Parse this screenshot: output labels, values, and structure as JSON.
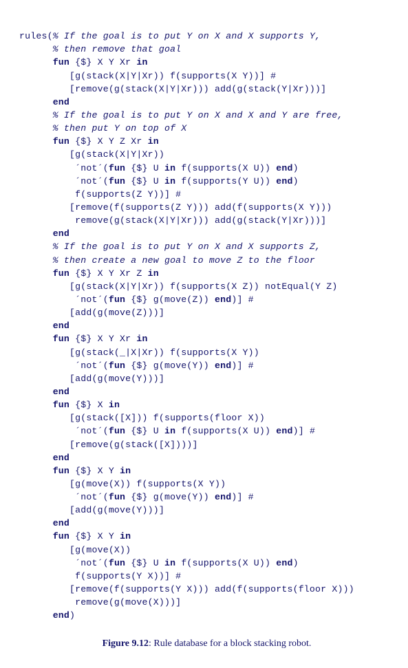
{
  "code": {
    "l01_a": "rules(",
    "l01_b": "% If the goal is to put Y on X and X supports Y,",
    "l02": "      % then remove that goal",
    "l03_a": "      ",
    "l03_b": "fun",
    "l03_c": " {$} X Y Xr ",
    "l03_d": "in",
    "l04": "         [g(stack(X|Y|Xr)) f(supports(X Y))] #",
    "l05": "         [remove(g(stack(X|Y|Xr))) add(g(stack(Y|Xr)))]",
    "l06_a": "      ",
    "l06_b": "end",
    "l07": "      % If the goal is to put Y on X and X and Y are free,",
    "l08": "      % then put Y on top of X",
    "l09_a": "      ",
    "l09_b": "fun",
    "l09_c": " {$} X Y Z Xr ",
    "l09_d": "in",
    "l10": "         [g(stack(X|Y|Xr))",
    "l11_a": "          ´not´(",
    "l11_b": "fun",
    "l11_c": " {$} U ",
    "l11_d": "in",
    "l11_e": " f(supports(X U)) ",
    "l11_f": "end",
    "l11_g": ")",
    "l12_a": "          ´not´(",
    "l12_b": "fun",
    "l12_c": " {$} U ",
    "l12_d": "in",
    "l12_e": " f(supports(Y U)) ",
    "l12_f": "end",
    "l12_g": ")",
    "l13": "          f(supports(Z Y))] #",
    "l14": "         [remove(f(supports(Z Y))) add(f(supports(X Y)))",
    "l15": "          remove(g(stack(X|Y|Xr))) add(g(stack(Y|Xr)))]",
    "l16_a": "      ",
    "l16_b": "end",
    "l17": "      % If the goal is to put Y on X and X supports Z,",
    "l18": "      % then create a new goal to move Z to the floor",
    "l19_a": "      ",
    "l19_b": "fun",
    "l19_c": " {$} X Y Xr Z ",
    "l19_d": "in",
    "l20": "         [g(stack(X|Y|Xr)) f(supports(X Z)) notEqual(Y Z)",
    "l21_a": "          ´not´(",
    "l21_b": "fun",
    "l21_c": " {$} g(move(Z)) ",
    "l21_d": "end",
    "l21_e": ")] #",
    "l22": "         [add(g(move(Z)))]",
    "l23_a": "      ",
    "l23_b": "end",
    "l24_a": "      ",
    "l24_b": "fun",
    "l24_c": " {$} X Y Xr ",
    "l24_d": "in",
    "l25": "         [g(stack(_|X|Xr)) f(supports(X Y))",
    "l26_a": "          ´not´(",
    "l26_b": "fun",
    "l26_c": " {$} g(move(Y)) ",
    "l26_d": "end",
    "l26_e": ")] #",
    "l27": "         [add(g(move(Y)))]",
    "l28_a": "      ",
    "l28_b": "end",
    "l29_a": "      ",
    "l29_b": "fun",
    "l29_c": " {$} X ",
    "l29_d": "in",
    "l30": "         [g(stack([X])) f(supports(floor X))",
    "l31_a": "          ´not´(",
    "l31_b": "fun",
    "l31_c": " {$} U ",
    "l31_d": "in",
    "l31_e": " f(supports(X U)) ",
    "l31_f": "end",
    "l31_g": ")] #",
    "l32": "         [remove(g(stack([X])))]",
    "l33_a": "      ",
    "l33_b": "end",
    "l34_a": "      ",
    "l34_b": "fun",
    "l34_c": " {$} X Y ",
    "l34_d": "in",
    "l35": "         [g(move(X)) f(supports(X Y))",
    "l36_a": "          ´not´(",
    "l36_b": "fun",
    "l36_c": " {$} g(move(Y)) ",
    "l36_d": "end",
    "l36_e": ")] #",
    "l37": "         [add(g(move(Y)))]",
    "l38_a": "      ",
    "l38_b": "end",
    "l39_a": "      ",
    "l39_b": "fun",
    "l39_c": " {$} X Y ",
    "l39_d": "in",
    "l40": "         [g(move(X))",
    "l41_a": "          ´not´(",
    "l41_b": "fun",
    "l41_c": " {$} U ",
    "l41_d": "in",
    "l41_e": " f(supports(X U)) ",
    "l41_f": "end",
    "l41_g": ")",
    "l42": "          f(supports(Y X))] #",
    "l43": "         [remove(f(supports(Y X))) add(f(supports(floor X)))",
    "l44": "          remove(g(move(X)))]",
    "l45_a": "      ",
    "l45_b": "end",
    "l45_c": ")"
  },
  "caption": {
    "label": "Figure 9.12",
    "sep": ": ",
    "text": "Rule database for a block stacking robot."
  }
}
